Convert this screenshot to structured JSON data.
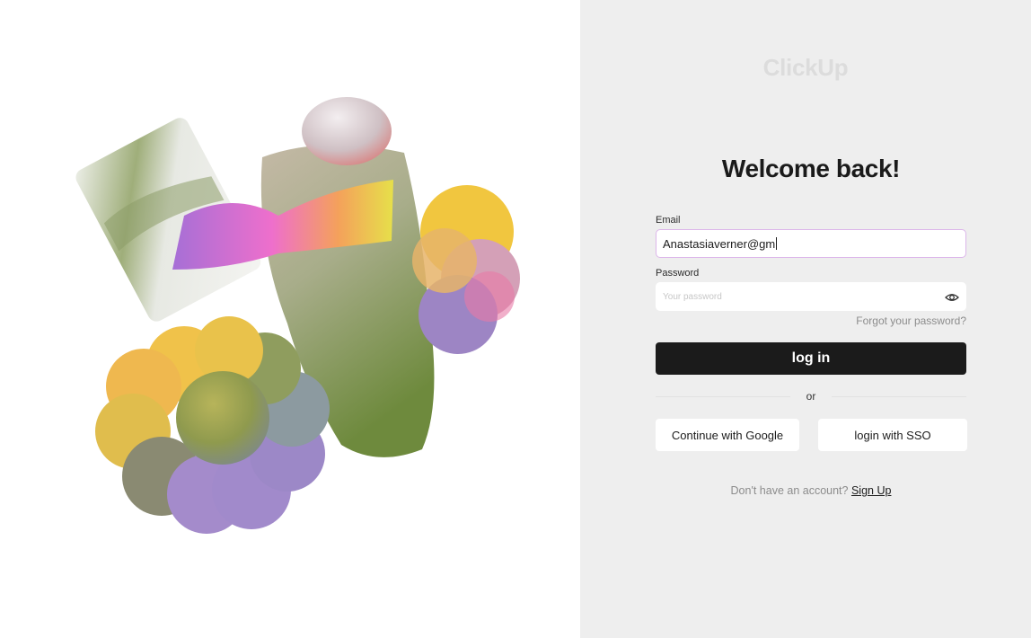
{
  "brand": {
    "logo_text": "ClickUp"
  },
  "form": {
    "title": "Welcome back!",
    "email_label": "Email",
    "email_value": "Anastasiaverner@gm",
    "password_label": "Password",
    "password_placeholder": "Your password",
    "forgot_link": "Forgot your password?",
    "login_button": "log in",
    "divider_text": "or",
    "google_button": "Continue with Google",
    "sso_button": "login with SSO",
    "signup_prompt": "Don't have an account?",
    "signup_link": "Sign Up"
  },
  "icons": {
    "password_toggle": "eye-icon"
  },
  "colors": {
    "primary_button": "#1b1b1b",
    "form_background": "#eeeeee",
    "focused_input_border": "#dcb6ea",
    "logo": "#dcdcdc"
  }
}
